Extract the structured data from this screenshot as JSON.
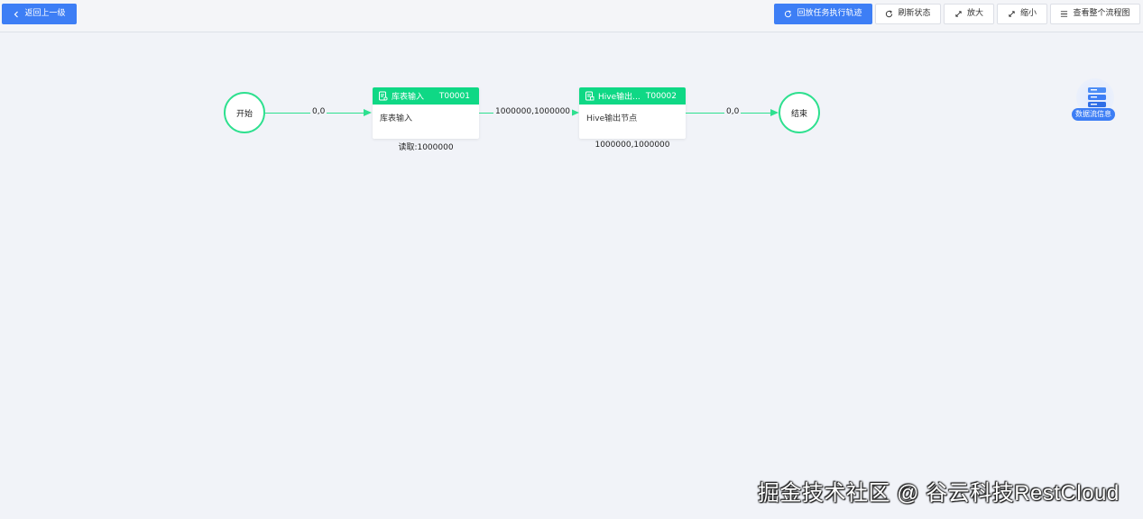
{
  "toolbar": {
    "back_label": "返回上一级",
    "replay_label": "回放任务执行轨迹",
    "refresh_label": "刷新状态",
    "zoom_in_label": "放大",
    "zoom_out_label": "缩小",
    "view_all_label": "查看整个流程图"
  },
  "flow": {
    "start_node": "开始",
    "end_node": "结束",
    "edges": [
      {
        "label": "0,0"
      },
      {
        "label": "1000000,1000000"
      },
      {
        "label": "0,0"
      }
    ],
    "tasks": [
      {
        "name": "库表输入",
        "id": "T00001",
        "body": "库表输入",
        "sub": "读取:1000000"
      },
      {
        "name": "Hive输出...",
        "id": "T00002",
        "body": "Hive输出节点",
        "sub": "1000000,1000000"
      }
    ],
    "accent_color": "#2ee08f",
    "header_color": "#0fd885"
  },
  "dataflow_info": {
    "label": "数据流信息"
  },
  "watermark": "掘金技术社区 @ 谷云科技RestCloud"
}
